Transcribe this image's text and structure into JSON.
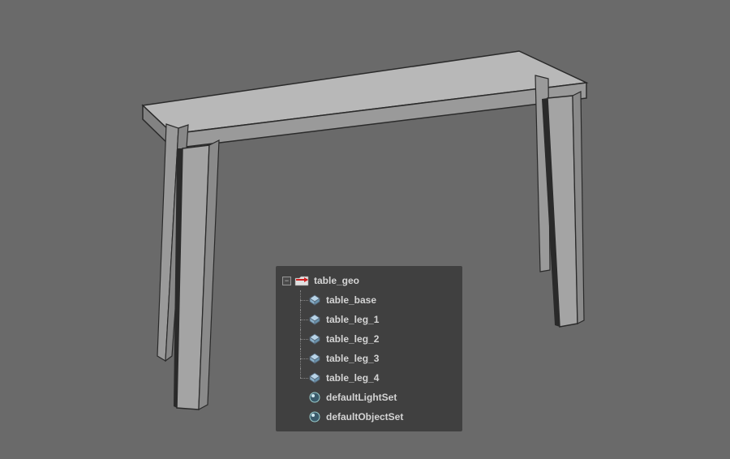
{
  "outliner": {
    "root": {
      "label": "table_geo",
      "expanded": true,
      "children": [
        {
          "label": "table_base"
        },
        {
          "label": "table_leg_1"
        },
        {
          "label": "table_leg_2"
        },
        {
          "label": "table_leg_3"
        },
        {
          "label": "table_leg_4"
        }
      ]
    },
    "sets": [
      {
        "label": "defaultLightSet"
      },
      {
        "label": "defaultObjectSet"
      }
    ]
  }
}
